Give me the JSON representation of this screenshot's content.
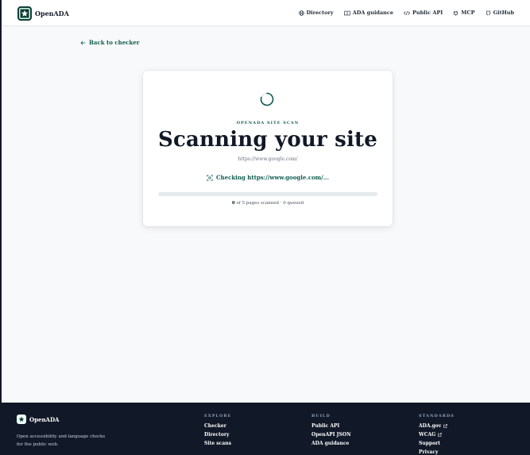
{
  "header": {
    "brand": "OpenADA",
    "nav": [
      {
        "label": "Directory",
        "icon": "globe-icon"
      },
      {
        "label": "ADA guidance",
        "icon": "book-icon"
      },
      {
        "label": "Public API",
        "icon": "code-icon"
      },
      {
        "label": "MCP",
        "icon": "plug-icon"
      },
      {
        "label": "GitHub",
        "icon": "github-icon"
      }
    ]
  },
  "back_link": "Back to checker",
  "scan": {
    "eyebrow": "OPENADA SITE SCAN",
    "title": "Scanning your site",
    "url": "https://www.google.com/",
    "status": "Checking https://www.google.com/...",
    "progress_fraction": 0,
    "scanned": "0",
    "stats_text": "of 5 pages scanned · 0 queued"
  },
  "footer": {
    "brand": "OpenADA",
    "tagline": "Open accessibility and language checks for the public web.",
    "columns": [
      {
        "heading": "EXPLORE",
        "links": [
          {
            "label": "Checker"
          },
          {
            "label": "Directory"
          },
          {
            "label": "Site scans"
          }
        ]
      },
      {
        "heading": "BUILD",
        "links": [
          {
            "label": "Public API"
          },
          {
            "label": "OpenAPI JSON"
          },
          {
            "label": "ADA guidance"
          }
        ]
      },
      {
        "heading": "STANDARDS",
        "links": [
          {
            "label": "ADA.gov",
            "external": true
          },
          {
            "label": "WCAG",
            "external": true
          },
          {
            "label": "Support"
          },
          {
            "label": "Privacy"
          }
        ]
      }
    ]
  },
  "colors": {
    "accent": "#0f5c4f",
    "footer_bg": "#111827",
    "page_bg": "#f8f9fa"
  }
}
